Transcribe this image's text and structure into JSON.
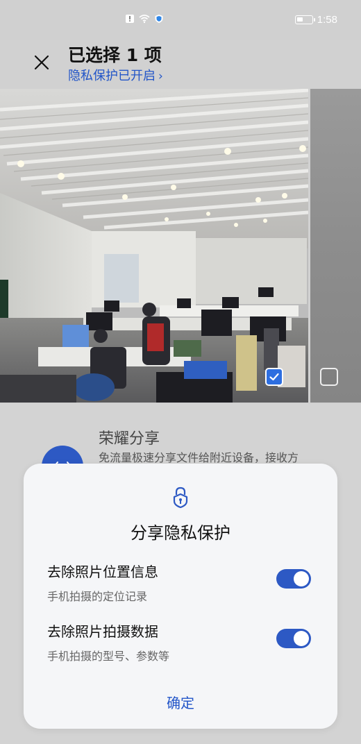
{
  "status_bar": {
    "time": "1:58",
    "icons": [
      "alert-icon",
      "wifi-icon",
      "shield-icon",
      "battery-icon"
    ]
  },
  "header": {
    "title": "已选择 1 项",
    "privacy_link": "隐私保护已开启",
    "privacy_chevron": "›"
  },
  "photos": {
    "selected_count": 1,
    "items": [
      {
        "checked": true
      },
      {
        "checked": false
      }
    ]
  },
  "share_option": {
    "title": "荣耀分享",
    "description": "免流量极速分享文件给附近设备，接收方"
  },
  "dialog": {
    "title": "分享隐私保护",
    "options": [
      {
        "title": "去除照片位置信息",
        "subtitle": "手机拍摄的定位记录",
        "enabled": true
      },
      {
        "title": "去除照片拍摄数据",
        "subtitle": "手机拍摄的型号、参数等",
        "enabled": true
      }
    ],
    "confirm_label": "确定"
  },
  "colors": {
    "accent": "#2d59c4",
    "link": "#2255c8",
    "dialog_bg": "#f5f6f8",
    "page_bg": "#d1d1d1"
  }
}
